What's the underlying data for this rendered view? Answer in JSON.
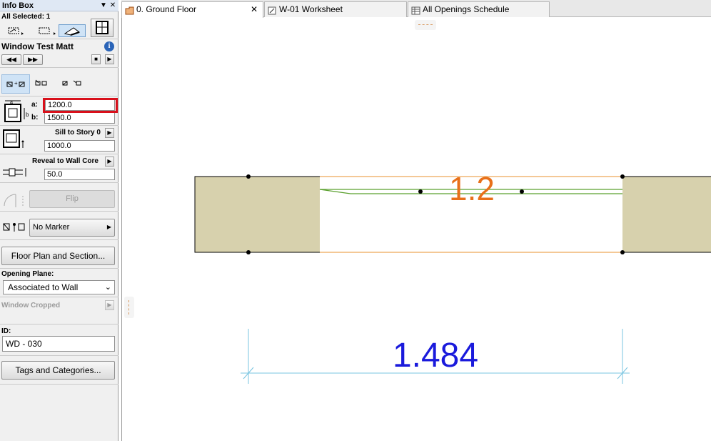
{
  "infobox": {
    "title": "Info Box",
    "pin_icon": "▼",
    "close_icon": "✕",
    "selection_label": "All Selected: 1",
    "element_name": "Window Test Matt",
    "info_icon": "i",
    "nav_prev": "◀◀",
    "nav_next": "▶▶",
    "dims": {
      "a_label": "a:",
      "a_value": "1200.0",
      "b_label": "b:",
      "b_value": "1500.0",
      "highlight_color": "#d8101b"
    },
    "sill": {
      "label": "Sill to Story 0",
      "value": "1000.0"
    },
    "reveal": {
      "label": "Reveal to Wall Core",
      "value": "50.0"
    },
    "flip_label": "Flip",
    "marker_label": "No Marker",
    "floor_plan_button": "Floor Plan and Section...",
    "opening_plane_label": "Opening Plane:",
    "opening_plane_value": "Associated to Wall",
    "window_cropped_label": "Window Cropped",
    "id_label": "ID:",
    "id_value": "WD - 030",
    "tags_button": "Tags and Categories..."
  },
  "tabs": [
    {
      "label": "0. Ground Floor",
      "icon": "floor-plan-icon",
      "active": true,
      "close": "✕"
    },
    {
      "label": "W-01 Worksheet",
      "icon": "worksheet-icon",
      "active": false
    },
    {
      "label": "All Openings Schedule",
      "icon": "schedule-icon",
      "active": false
    }
  ],
  "drawing": {
    "window_label": "1.2",
    "window_label_color": "#e8701a",
    "dimension_value": "1.484",
    "dimension_color": "#1a1adc",
    "wall_fill": "#d7d1ad",
    "opening_line_color": "#e8902e",
    "sash_color": "#5aa02e",
    "dimension_line_color": "#78c4e0"
  }
}
